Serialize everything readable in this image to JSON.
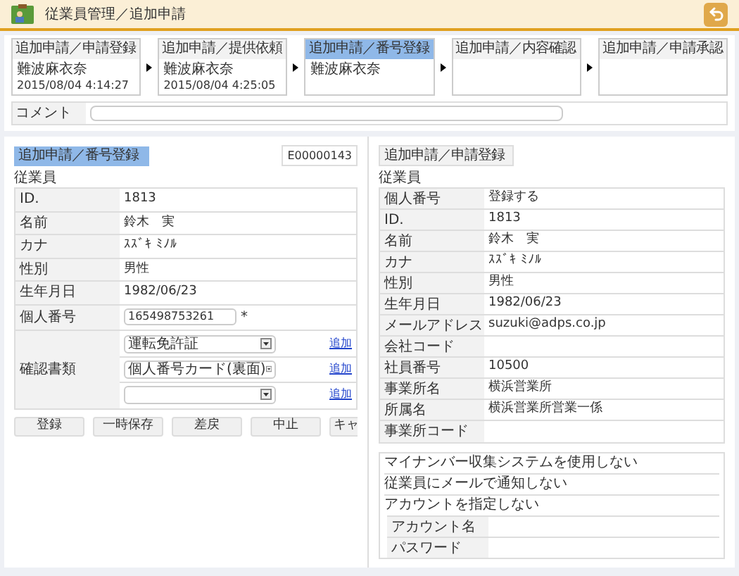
{
  "header": {
    "title": "従業員管理／追加申請"
  },
  "steps": [
    {
      "title": "追加申請／申請登録",
      "selected": false,
      "name": "難波麻衣奈",
      "time": "2015/08/04 4:14:27"
    },
    {
      "title": "追加申請／提供依頼",
      "selected": false,
      "name": "難波麻衣奈",
      "time": "2015/08/04 4:25:05"
    },
    {
      "title": "追加申請／番号登録",
      "selected": true,
      "name": "難波麻衣奈"
    },
    {
      "title": "追加申請／内容確認",
      "selected": false
    },
    {
      "title": "追加申請／申請承認",
      "selected": false
    }
  ],
  "comment": {
    "label": "コメント"
  },
  "left": {
    "badge": "追加申請／番号登録",
    "code": "E00000143",
    "section_label": "従業員",
    "rows": [
      {
        "kind": "text",
        "label": "ID.",
        "value": "1813"
      },
      {
        "kind": "text",
        "label": "名前",
        "value": "鈴木　実"
      },
      {
        "kind": "text",
        "label": "カナ",
        "value": "ｽｽﾞｷ ﾐﾉﾙ"
      },
      {
        "kind": "text",
        "label": "性別",
        "value": "男性"
      },
      {
        "kind": "text",
        "label": "生年月日",
        "value": "1982/06/23"
      },
      {
        "kind": "input",
        "label": "個人番号",
        "value": "165498753261",
        "mark": "*"
      },
      {
        "kind": "docs",
        "label": "確認書類",
        "docs": [
          {
            "value": "運転免許証",
            "link": "追加"
          },
          {
            "value": "個人番号カード(裏面)",
            "link": "追加"
          },
          {
            "link": "追加"
          }
        ]
      }
    ],
    "buttons": [
      "登録",
      "一時保存",
      "差戻",
      "中止",
      "キャ"
    ]
  },
  "right": {
    "badge": "追加申請／申請登録",
    "section_label": "従業員",
    "rows": [
      {
        "label": "個人番号",
        "value": "登録する"
      },
      {
        "label": "ID.",
        "value": "1813"
      },
      {
        "label": "名前",
        "value": "鈴木　実"
      },
      {
        "label": "カナ",
        "value": "ｽｽﾞｷ ﾐﾉﾙ"
      },
      {
        "label": "性別",
        "value": "男性"
      },
      {
        "label": "生年月日",
        "value": "1982/06/23"
      },
      {
        "label": "メールアドレス",
        "value": "suzuki@adps.co.jp"
      },
      {
        "label": "会社コード"
      },
      {
        "label": "社員番号",
        "value": "10500"
      },
      {
        "label": "事業所名",
        "value": "横浜営業所"
      },
      {
        "label": "所属名",
        "value": "横浜営業所営業一係"
      },
      {
        "label": "事業所コード"
      }
    ],
    "options": [
      {
        "text": "マイナンバー収集システムを使用しない"
      },
      {
        "text": "従業員にメールで通知しない"
      },
      {
        "text": "アカウントを指定しない",
        "rows": [
          {
            "label": "アカウント名"
          },
          {
            "label": "パスワード"
          }
        ]
      }
    ]
  }
}
